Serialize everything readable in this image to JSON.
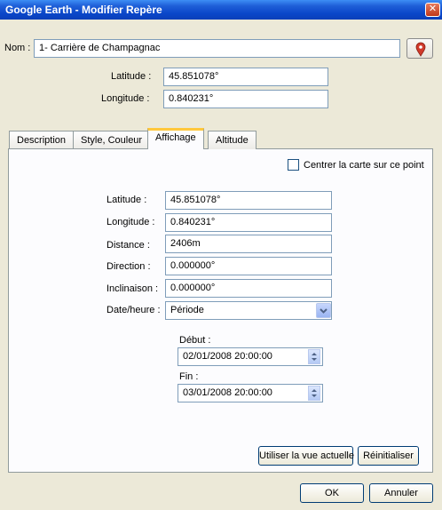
{
  "window": {
    "title": "Google Earth - Modifier Repère",
    "close_glyph": "✕"
  },
  "name": {
    "label": "Nom :",
    "value": "1- Carrière de Champagnac"
  },
  "top_coords": {
    "latitude_label": "Latitude :",
    "latitude": "45.851078°",
    "longitude_label": "Longitude :",
    "longitude": "0.840231°"
  },
  "tabs": [
    {
      "label": "Description"
    },
    {
      "label": "Style, Couleur"
    },
    {
      "label": "Affichage"
    },
    {
      "label": "Altitude"
    }
  ],
  "active_tab": "Affichage",
  "view": {
    "center_checkbox_label": "Centrer la carte sur ce point",
    "center_checked": false,
    "latitude_label": "Latitude :",
    "latitude": "45.851078°",
    "longitude_label": "Longitude :",
    "longitude": "0.840231°",
    "distance_label": "Distance :",
    "distance": "2406m",
    "direction_label": "Direction :",
    "direction": "0.000000°",
    "tilt_label": "Inclinaison :",
    "tilt": "0.000000°",
    "datetime_label": "Date/heure :",
    "datetime": "Période",
    "start_label": "Début :",
    "start": "02/01/2008 20:00:00",
    "end_label": "Fin :",
    "end": "03/01/2008 20:00:00",
    "use_current_view_button": "Utiliser la vue actuelle",
    "reset_button": "Réinitialiser"
  },
  "footer": {
    "ok_button": "OK",
    "cancel_button": "Annuler"
  },
  "icons": {
    "pin": "placemark-pin-icon",
    "dropdown": "chevron-down-icon",
    "spin": "spin-arrows-icon"
  },
  "colors": {
    "titlebar": "#0a46c9",
    "active_tab_accent": "#ffc83c",
    "pin": "#d03a2b"
  }
}
